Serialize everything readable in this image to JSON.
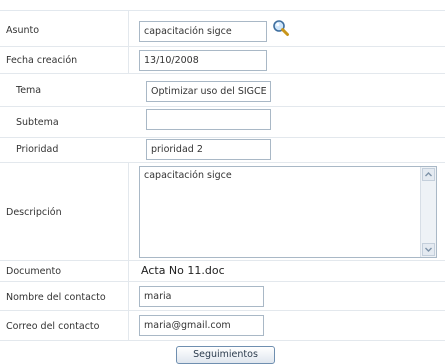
{
  "form": {
    "asunto": {
      "label": "Asunto",
      "value": "capacitación sigce"
    },
    "fecha": {
      "label": "Fecha creación",
      "value": "13/10/2008"
    },
    "tema": {
      "label": "Tema",
      "value": "Optimizar uso del SIGCE"
    },
    "subtema": {
      "label": "Subtema",
      "value": ""
    },
    "prioridad": {
      "label": "Prioridad",
      "value": "prioridad 2"
    },
    "descripcion": {
      "label": "Descripción",
      "value": "capacitación sigce"
    },
    "documento": {
      "label": "Documento",
      "value": "Acta No 11.doc"
    },
    "contacto": {
      "label": "Nombre del contacto",
      "value": "maria"
    },
    "correo": {
      "label": "Correo del contacto",
      "value": "maria@gmail.com"
    }
  },
  "buttons": {
    "seguimientos": "Seguimientos"
  },
  "icons": {
    "search": "magnifier-icon"
  }
}
